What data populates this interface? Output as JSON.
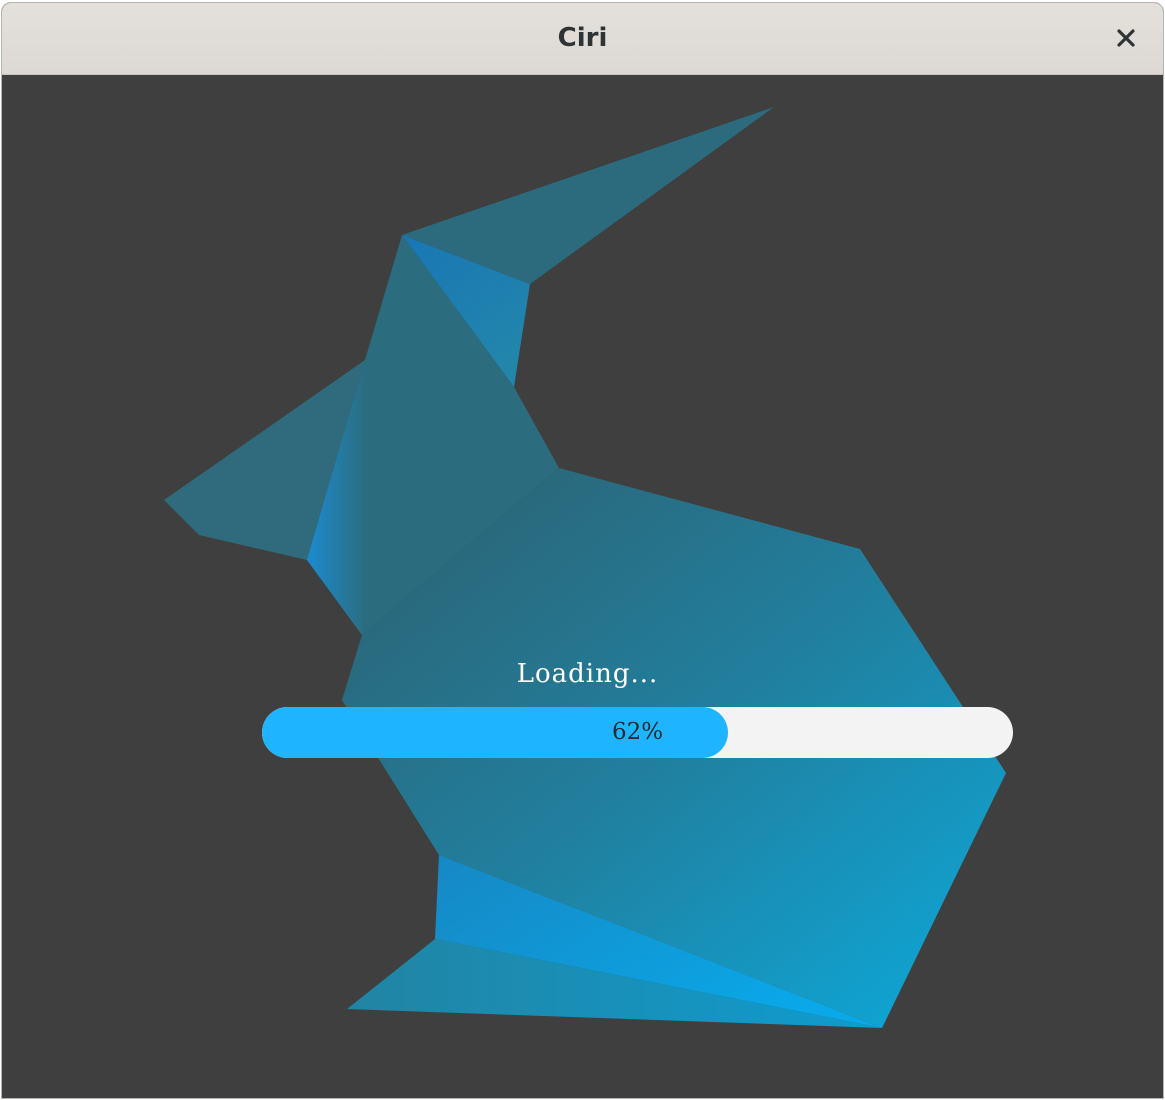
{
  "window": {
    "title": "Ciri",
    "close_icon": "close-icon"
  },
  "loading": {
    "text": "Loading...",
    "progress": 0.62,
    "progress_label": "62%"
  },
  "colors": {
    "background": "#3f3f3f",
    "accent": "#1eb4ff",
    "track": "#f3f3f3",
    "bunny_dark": "#2d6b7f",
    "bunny_light": "#0ca9dc"
  }
}
